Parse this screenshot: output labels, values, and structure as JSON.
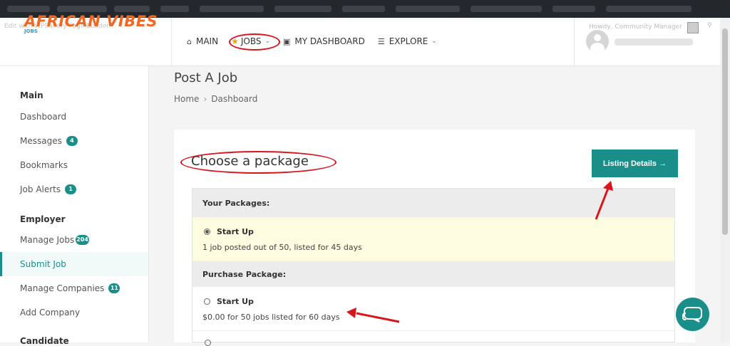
{
  "header": {
    "edit_link": "Edit with WPBakery Page Builder",
    "logo_text": "AFRICAN VIBES",
    "logo_sub": "JOBS",
    "howdy": "Howdy, Community Manager"
  },
  "nav": [
    {
      "label": "MAIN",
      "icon": "home-icon"
    },
    {
      "label": "JOBS",
      "icon": "star-icon",
      "has_dropdown": true
    },
    {
      "label": "MY DASHBOARD",
      "icon": "id-card-icon"
    },
    {
      "label": "EXPLORE",
      "icon": "list-icon",
      "has_dropdown": true
    }
  ],
  "sidebar": {
    "main_heading": "Main",
    "main_items": [
      {
        "label": "Dashboard"
      },
      {
        "label": "Messages",
        "badge": "4"
      },
      {
        "label": "Bookmarks"
      },
      {
        "label": "Job Alerts",
        "badge": "1"
      }
    ],
    "employer_heading": "Employer",
    "employer_items": [
      {
        "label": "Manage Jobs",
        "badge": "204"
      },
      {
        "label": "Submit Job",
        "active": true
      },
      {
        "label": "Manage Companies",
        "badge": "11"
      },
      {
        "label": "Add Company"
      }
    ],
    "candidate_heading": "Candidate"
  },
  "page": {
    "title": "Post A Job",
    "breadcrumb": [
      "Home",
      "Dashboard"
    ]
  },
  "card": {
    "heading": "Choose a package",
    "listing_button": "Listing Details →",
    "your_packages_heading": "Your Packages:",
    "your_packages": [
      {
        "name": "Start Up",
        "desc": "1 job posted out of 50, listed for 45 days",
        "selected": true
      }
    ],
    "purchase_heading": "Purchase Package:",
    "purchase_packages": [
      {
        "name": "Start Up",
        "desc": "$0.00 for 50 jobs listed for 60 days",
        "selected": false
      }
    ]
  },
  "colors": {
    "accent": "#1a8f8a",
    "annotation": "#d9141b",
    "logo": "#f26722",
    "selected_row": "#fdfce0"
  }
}
